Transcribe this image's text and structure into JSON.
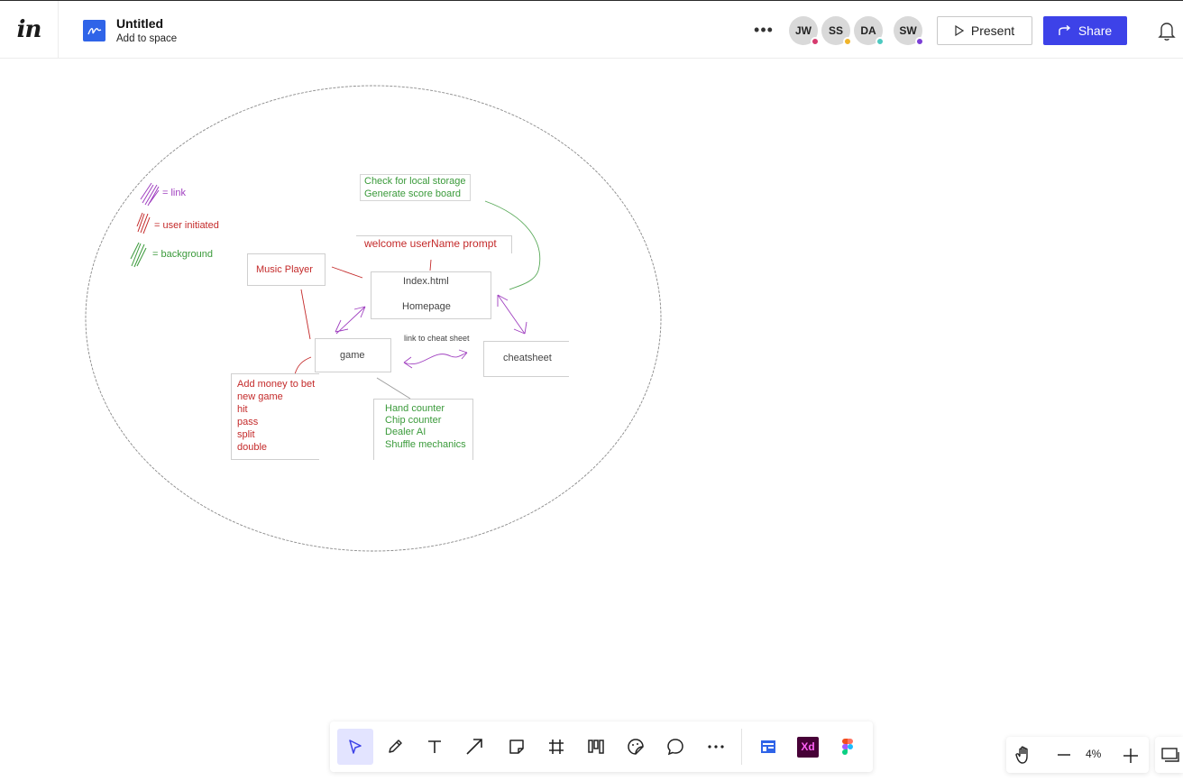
{
  "header": {
    "logo_text": "in",
    "doc_title": "Untitled",
    "doc_subtitle": "Add to space",
    "more_label": "•••",
    "collaborators": [
      {
        "initials": "JW",
        "dot_color": "#d63a6e"
      },
      {
        "initials": "SS",
        "dot_color": "#f0b429"
      },
      {
        "initials": "DA",
        "dot_color": "#4cc9c0"
      },
      {
        "initials": "SW",
        "dot_color": "#7b3fd6"
      }
    ],
    "present_label": "Present",
    "share_label": "Share"
  },
  "board": {
    "legend": [
      {
        "label": "= link",
        "color": "#a040c0"
      },
      {
        "label": "= user initiated",
        "color": "#c42a2a"
      },
      {
        "label": "= background",
        "color": "#3a9a3a"
      }
    ],
    "notes": {
      "storage_line1": "Check for local storage",
      "storage_line2": "Generate score board",
      "welcome": "welcome userName prompt",
      "music_player": "Music Player",
      "index_title": "Index.html",
      "index_sub": "Homepage",
      "game": "game",
      "link_cheat": "link to cheat sheet",
      "cheatsheet": "cheatsheet",
      "user_actions": [
        "Add money to bet",
        "new game",
        "hit",
        "pass",
        "split",
        "double"
      ],
      "background_tasks": [
        "Hand counter",
        "Chip counter",
        "Dealer AI",
        "Shuffle mechanics"
      ]
    }
  },
  "toolbar": {
    "tools": [
      "select-tool",
      "pencil-tool",
      "text-tool",
      "arrow-tool",
      "sticky-note-tool",
      "frame-tool",
      "layout-tool",
      "sticker-tool",
      "comment-tool",
      "more-tools"
    ],
    "integrations": [
      "freehand-widget-icon",
      "adobe-xd-icon",
      "figma-icon"
    ],
    "xd_label": "Xd"
  },
  "zoom": {
    "value": "4%"
  }
}
